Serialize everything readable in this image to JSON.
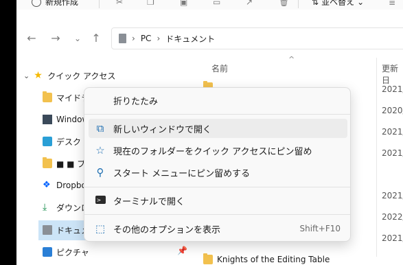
{
  "command_bar": {
    "new_label": "新規作成",
    "sort_label": "並べ替え",
    "icons": [
      "cut-icon",
      "copy-icon",
      "paste-icon",
      "rename-icon",
      "share-icon",
      "delete-icon",
      "more-icon"
    ]
  },
  "nav": {
    "back_icon": "back-arrow-icon",
    "forward_icon": "forward-arrow-icon",
    "recent_icon": "chevron-down-icon",
    "up_icon": "up-arrow-icon",
    "breadcrumb": [
      "PC",
      "ドキュメント"
    ]
  },
  "sidebar": {
    "quick_access": "クイック アクセス",
    "items": [
      {
        "label": "マイドライ"
      },
      {
        "label": "Window"
      },
      {
        "label": "デスクト"
      },
      {
        "label": "■ ■ プロ"
      },
      {
        "label": "Dropbo"
      },
      {
        "label": "ダウンロ"
      },
      {
        "label": "ドキュメ"
      },
      {
        "label": "ピクチャ"
      }
    ]
  },
  "main": {
    "col_name": "名前",
    "col_date": "更新日",
    "dates": [
      "2021/",
      "2020/",
      "2021/",
      "2021/",
      "2021/",
      "2022/",
      "2021/"
    ],
    "files": [
      {
        "name": ""
      },
      {
        "name": "Knights of the Editing Table"
      }
    ]
  },
  "context_menu": {
    "items": [
      {
        "label": "折りたたみ",
        "icon": ""
      },
      {
        "label": "新しいウィンドウで開く",
        "icon": "open-new-window-icon"
      },
      {
        "label": "現在のフォルダーをクイック アクセスにピン留め",
        "icon": "star-outline-icon"
      },
      {
        "label": "スタート メニューにピン留めする",
        "icon": "pin-icon"
      },
      {
        "label": "ターミナルで開く",
        "icon": "terminal-icon"
      },
      {
        "label": "その他のオプションを表示",
        "icon": "show-more-options-icon",
        "shortcut": "Shift+F10"
      }
    ]
  }
}
